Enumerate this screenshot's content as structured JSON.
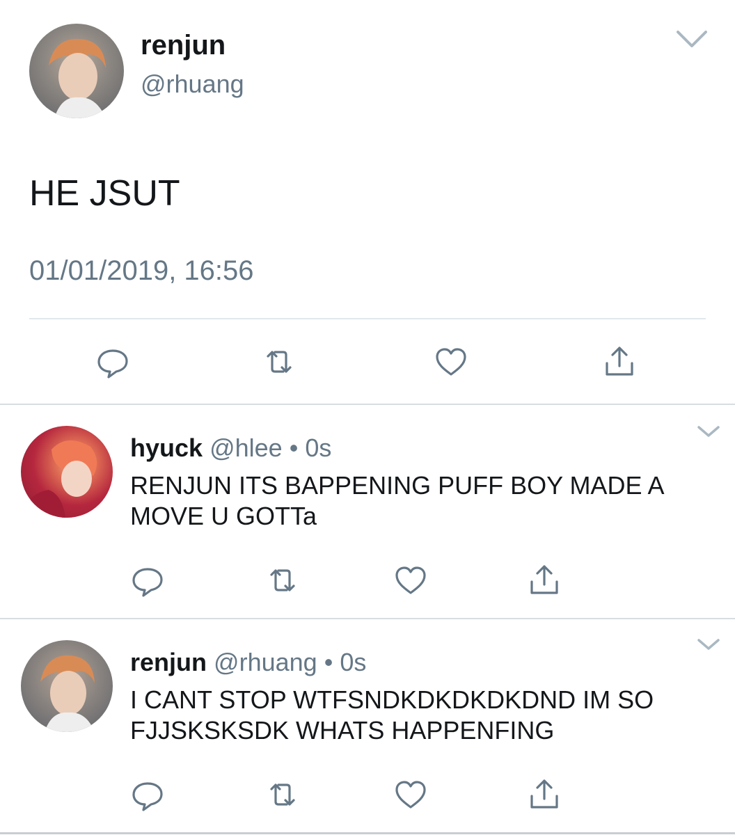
{
  "main_tweet": {
    "name": "renjun",
    "handle": "@rhuang",
    "text": "HE JSUT",
    "timestamp": "01/01/2019, 16:56",
    "actions": [
      "reply-icon",
      "retweet-icon",
      "like-icon",
      "share-icon"
    ]
  },
  "replies": [
    {
      "name": "hyuck",
      "handle": "@hlee",
      "dot": "•",
      "time": "0s",
      "text": "RENJUN ITS BAPPENING PUFF BOY MADE A MOVE U GOTTa"
    },
    {
      "name": "renjun",
      "handle": "@rhuang",
      "dot": "•",
      "time": "0s",
      "text": "I CANT STOP WTFSNDKDKDKDKDND  IM SO FJJSKSKSDK WHATS HAPPENFING"
    }
  ],
  "colors": {
    "text": "#14171a",
    "secondary": "#657786",
    "divider": "#e1e8ed",
    "icon": "#657786"
  }
}
